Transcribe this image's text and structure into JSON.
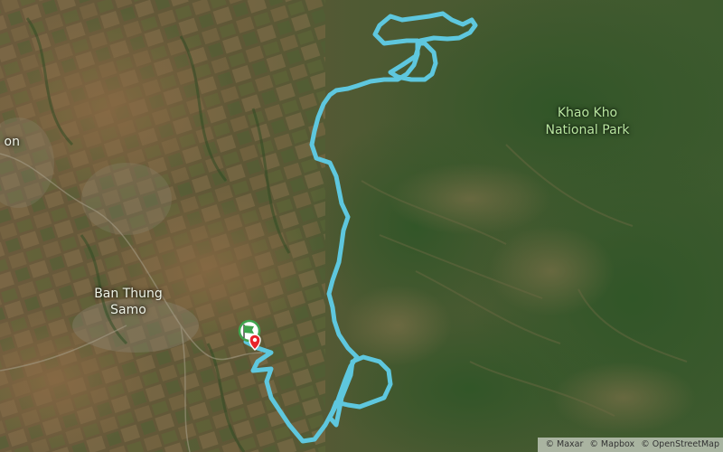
{
  "map": {
    "labels": {
      "park_line1": "Khao Kho",
      "park_line2": "National Park",
      "village_line1": "Ban Thung",
      "village_line2": "Samo",
      "partial": "on"
    },
    "route_color": "#5ec7de",
    "marker": {
      "start_color": "#3fa34d",
      "end_color": "#e8232b",
      "icon": "start-end-flag-marker"
    }
  },
  "attribution": {
    "maxar": "© Maxar",
    "mapbox": "© Mapbox",
    "osm": "© OpenStreetMap"
  }
}
